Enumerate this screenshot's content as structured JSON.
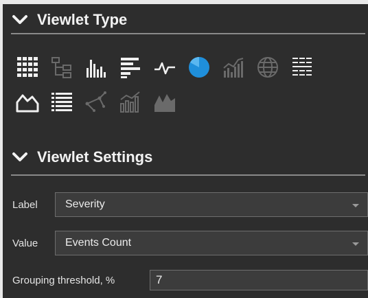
{
  "viewlet_type": {
    "title": "Viewlet Type",
    "icons": [
      {
        "name": "table-grid-icon",
        "state": "available"
      },
      {
        "name": "tree-hierarchy-icon",
        "state": "disabled"
      },
      {
        "name": "column-chart-icon",
        "state": "available"
      },
      {
        "name": "bar-chart-icon",
        "state": "available"
      },
      {
        "name": "line-chart-icon",
        "state": "available"
      },
      {
        "name": "pie-chart-icon",
        "state": "selected"
      },
      {
        "name": "combo-chart-icon",
        "state": "disabled"
      },
      {
        "name": "globe-map-icon",
        "state": "disabled"
      },
      {
        "name": "matrix-table-icon",
        "state": "available"
      },
      {
        "name": "area-chart-icon",
        "state": "available"
      },
      {
        "name": "list-icon",
        "state": "available"
      },
      {
        "name": "scatter-icon",
        "state": "disabled"
      },
      {
        "name": "bar-line-chart-icon",
        "state": "disabled"
      },
      {
        "name": "stacked-area-icon",
        "state": "disabled"
      }
    ]
  },
  "viewlet_settings": {
    "title": "Viewlet Settings",
    "label_field": {
      "label": "Label",
      "value": "Severity"
    },
    "value_field": {
      "label": "Value",
      "value": "Events Count"
    },
    "threshold_field": {
      "label": "Grouping threshold, %",
      "value": "7"
    }
  },
  "colors": {
    "background": "#2d2d2d",
    "icon_available": "#f0f0f0",
    "icon_disabled": "#6a6a6a",
    "selected_accent": "#1f8fdb"
  }
}
